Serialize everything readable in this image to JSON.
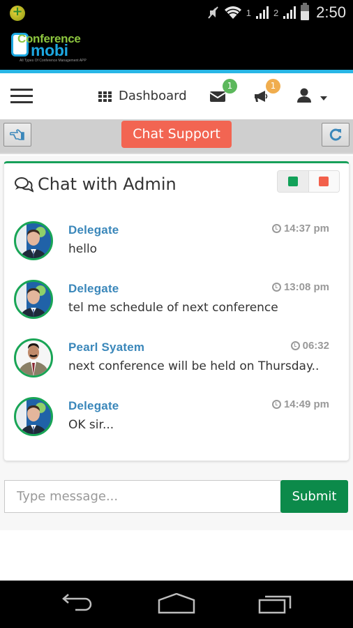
{
  "status_bar": {
    "sim1_label": "1",
    "sim2_label": "2",
    "time": "2:50",
    "icons": [
      "app-notification-icon",
      "mute-icon",
      "wifi-icon",
      "signal-icon",
      "signal-icon",
      "battery-icon"
    ]
  },
  "app": {
    "logo_line1": "Conference",
    "logo_line2": "mobi",
    "logo_tagline": "All Types Of Conference Management APP",
    "brand_colors": {
      "accent": "#29b6e6",
      "green": "#8dc63f",
      "blue": "#1ca7e0"
    }
  },
  "nav": {
    "menu_icon": "hamburger-icon",
    "dashboard_label": "Dashboard",
    "messages_badge": "1",
    "notifications_badge": "1",
    "user_icon": "user-icon"
  },
  "toolbar": {
    "left_button_icon": "hand-point-left-icon",
    "title_button": "Chat Support",
    "right_button_icon": "refresh-icon",
    "title_color": "#f26552"
  },
  "chat_panel": {
    "title": "Chat with Admin",
    "title_icon": "comments-icon",
    "status_toggle": [
      {
        "name": "online",
        "color": "#12a159",
        "active": true
      },
      {
        "name": "offline",
        "color": "#f2604b",
        "active": false
      }
    ],
    "messages": [
      {
        "sender": "Delegate",
        "text": "hello",
        "time": "14:37 pm",
        "avatar": "delegate"
      },
      {
        "sender": "Delegate",
        "text": "tel me schedule of next conference",
        "time": "13:08 pm",
        "avatar": "delegate"
      },
      {
        "sender": "Pearl Syatem",
        "text": "next conference will be held on Thursday..",
        "time": "06:32",
        "avatar": "pearl"
      },
      {
        "sender": "Delegate",
        "text": "OK sir...",
        "time": "14:49 pm",
        "avatar": "delegate"
      }
    ]
  },
  "composer": {
    "placeholder": "Type message...",
    "value": "",
    "submit_label": "Submit",
    "submit_color": "#0c8a4a"
  },
  "android_nav": {
    "buttons": [
      "back-icon",
      "home-icon",
      "recent-apps-icon"
    ]
  }
}
